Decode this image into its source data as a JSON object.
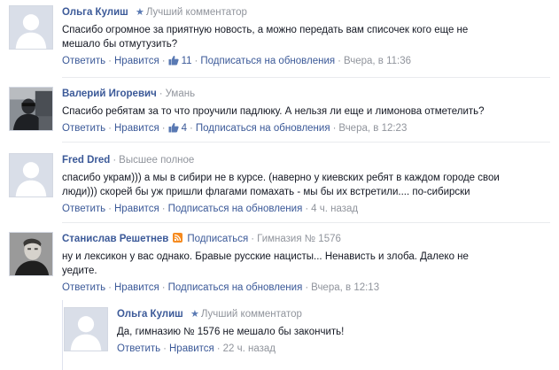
{
  "comments": [
    {
      "author": "Ольга Кулиш",
      "badge": "Лучший комментатор",
      "location": "",
      "text": "Спасибо огромное за приятную новость, а можно передать вам списочек кого еще не мешало бы отмутузить?",
      "reply": "Ответить",
      "like": "Нравится",
      "likes": "11",
      "subscribe": "Подписаться на обновления",
      "time": "Вчера, в 11:36",
      "avatar_icon": "default-avatar-icon"
    },
    {
      "author": "Валерий Игоревич",
      "location": "Умань",
      "text": "Спасибо ребятам за то что проучили падлюку. А нельзя ли еще и лимонова отметелить?",
      "reply": "Ответить",
      "like": "Нравится",
      "likes": "4",
      "subscribe": "Подписаться на обновления",
      "time": "Вчера, в 12:23",
      "avatar_icon": "user-photo-icon"
    },
    {
      "author": "Fred Dred",
      "location": "Высшее полное",
      "text": "спасибо укрaм))) а мы в сибири не в курсе. (наверно у киевских ребят в каждом городе свои люди))) скорей бы уж пришли флагами помахать - мы бы их встретили.... по-сибирски",
      "reply": "Ответить",
      "like": "Нравится",
      "subscribe": "Подписаться на обновления",
      "time": "4 ч. назад",
      "avatar_icon": "default-avatar-icon"
    },
    {
      "author": "Станислав Решетнев",
      "subscribe_author": "Подписаться",
      "location": "Гимназия № 1576",
      "text": "ну и лексикон у вас однако. Бравые русские нацисты... Ненависть и злоба. Далеко не уедите.",
      "reply": "Ответить",
      "like": "Нравится",
      "subscribe": "Подписаться на обновления",
      "time": "Вчера, в 12:13",
      "avatar_icon": "user-photo-icon"
    }
  ],
  "reply": {
    "author": "Ольга Кулиш",
    "badge": "Лучший комментатор",
    "text": "Да, гимназию № 1576 не мешало бы закончить!",
    "reply": "Ответить",
    "like": "Нравится",
    "time": "22 ч. назад",
    "avatar_icon": "default-avatar-icon"
  },
  "colors": {
    "link": "#3b5998",
    "meta": "#90949c",
    "text": "#141823",
    "star": "#5979b3",
    "rss": "#f68a1e"
  }
}
